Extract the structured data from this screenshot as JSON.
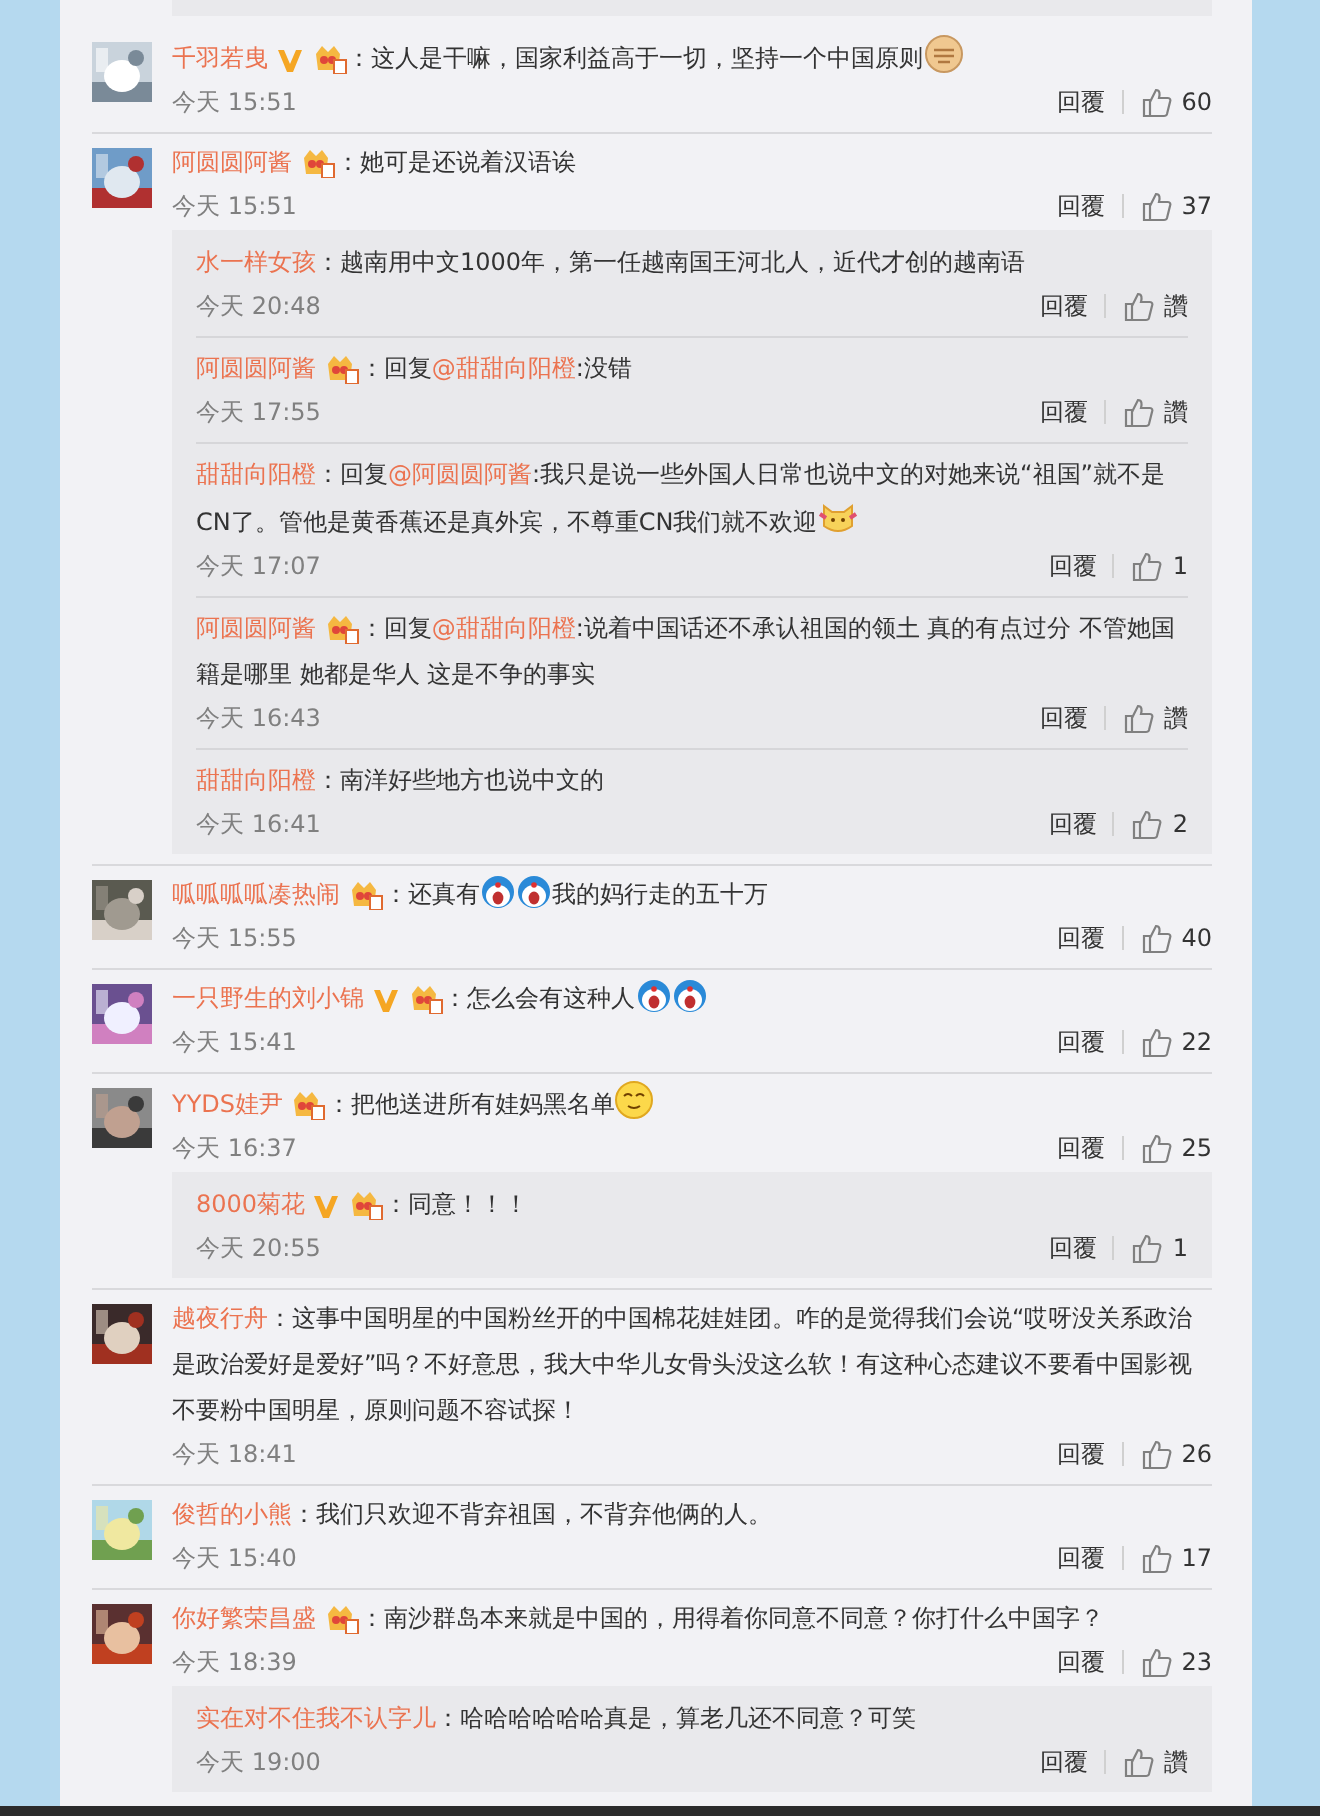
{
  "comments": [
    {
      "user": "千羽若曳",
      "verified": true,
      "member": true,
      "parts": [
        {
          "kind": "text",
          "text": "：这人是干嘛，国家利益高于一切，坚持一个中国原则"
        },
        {
          "kind": "fist"
        }
      ],
      "time": "今天 15:51",
      "reply": "回覆",
      "likes": "60"
    },
    {
      "user": "阿圆圆阿酱",
      "verified": false,
      "member": true,
      "parts": [
        {
          "kind": "text",
          "text": "：她可是还说着汉语诶"
        }
      ],
      "time": "今天 15:51",
      "reply": "回覆",
      "likes": "37",
      "replies": [
        {
          "user": "水一样女孩",
          "verified": false,
          "member": false,
          "parts": [
            {
              "kind": "text",
              "text": "：越南用中文1000年，第一任越南国王河北人，近代才创的越南语"
            }
          ],
          "time": "今天 20:48",
          "reply": "回覆",
          "likes": "讚"
        },
        {
          "user": "阿圆圆阿酱",
          "verified": false,
          "member": true,
          "parts": [
            {
              "kind": "text",
              "text": "：回复"
            },
            {
              "kind": "mention",
              "text": "@甜甜向阳橙"
            },
            {
              "kind": "text",
              "text": ":没错"
            }
          ],
          "time": "今天 17:55",
          "reply": "回覆",
          "likes": "讚"
        },
        {
          "user": "甜甜向阳橙",
          "verified": false,
          "member": false,
          "parts": [
            {
              "kind": "text",
              "text": "：回复"
            },
            {
              "kind": "mention",
              "text": "@阿圆圆阿酱"
            },
            {
              "kind": "text",
              "text": ":我只是说一些外国人日常也说中文的对她来说“祖国”就不是CN了。管他是黄香蕉还是真外宾，不尊重CN我们就不欢迎"
            },
            {
              "kind": "cat"
            }
          ],
          "time": "今天 17:07",
          "reply": "回覆",
          "likes": "1"
        },
        {
          "user": "阿圆圆阿酱",
          "verified": false,
          "member": true,
          "parts": [
            {
              "kind": "text",
              "text": "：回复"
            },
            {
              "kind": "mention",
              "text": "@甜甜向阳橙"
            },
            {
              "kind": "text",
              "text": ":说着中国话还不承认祖国的领土 真的有点过分 不管她国籍是哪里 她都是华人 这是不争的事实"
            }
          ],
          "time": "今天 16:43",
          "reply": "回覆",
          "likes": "讚"
        },
        {
          "user": "甜甜向阳橙",
          "verified": false,
          "member": false,
          "parts": [
            {
              "kind": "text",
              "text": "：南洋好些地方也说中文的"
            }
          ],
          "time": "今天 16:41",
          "reply": "回覆",
          "likes": "2"
        }
      ]
    },
    {
      "user": "呱呱呱呱凑热闹",
      "verified": false,
      "member": true,
      "parts": [
        {
          "kind": "text",
          "text": "：还真有"
        },
        {
          "kind": "blueface"
        },
        {
          "kind": "blueface"
        },
        {
          "kind": "text",
          "text": "我的妈行走的五十万"
        }
      ],
      "time": "今天 15:55",
      "reply": "回覆",
      "likes": "40"
    },
    {
      "user": "一只野生的刘小锦",
      "verified": true,
      "member": true,
      "parts": [
        {
          "kind": "text",
          "text": "：怎么会有这种人"
        },
        {
          "kind": "blueface"
        },
        {
          "kind": "blueface"
        }
      ],
      "time": "今天 15:41",
      "reply": "回覆",
      "likes": "22"
    },
    {
      "user": "YYDS娃尹",
      "verified": false,
      "member": true,
      "parts": [
        {
          "kind": "text",
          "text": "：把他送进所有娃妈黑名单"
        },
        {
          "kind": "smiley"
        }
      ],
      "time": "今天 16:37",
      "reply": "回覆",
      "likes": "25",
      "replies": [
        {
          "user": "8000菊花",
          "verified": true,
          "member": true,
          "parts": [
            {
              "kind": "text",
              "text": "：同意！！！"
            }
          ],
          "time": "今天 20:55",
          "reply": "回覆",
          "likes": "1"
        }
      ]
    },
    {
      "user": "越夜行舟",
      "verified": false,
      "member": false,
      "parts": [
        {
          "kind": "text",
          "text": "：这事中国明星的中国粉丝开的中国棉花娃娃团。咋的是觉得我们会说“哎呀没关系政治是政治爱好是爱好”吗？不好意思，我大中华儿女骨头没这么软！有这种心态建议不要看中国影视不要粉中国明星，原则问题不容试探！"
        }
      ],
      "time": "今天 18:41",
      "reply": "回覆",
      "likes": "26"
    },
    {
      "user": "俊哲的小熊",
      "verified": false,
      "member": false,
      "parts": [
        {
          "kind": "text",
          "text": "：我们只欢迎不背弃祖国，不背弃他俩的人。"
        }
      ],
      "time": "今天 15:40",
      "reply": "回覆",
      "likes": "17"
    },
    {
      "user": "你好繁荣昌盛",
      "verified": false,
      "member": true,
      "parts": [
        {
          "kind": "text",
          "text": "：南沙群岛本来就是中国的，用得着你同意不同意？你打什么中国字？"
        }
      ],
      "time": "今天 18:39",
      "reply": "回覆",
      "likes": "23",
      "replies": [
        {
          "user": "实在对不住我不认字儿",
          "verified": false,
          "member": false,
          "parts": [
            {
              "kind": "text",
              "text": "：哈哈哈哈哈哈真是，算老几还不同意？可笑"
            }
          ],
          "time": "今天 19:00",
          "reply": "回覆",
          "likes": "讚"
        }
      ]
    }
  ]
}
